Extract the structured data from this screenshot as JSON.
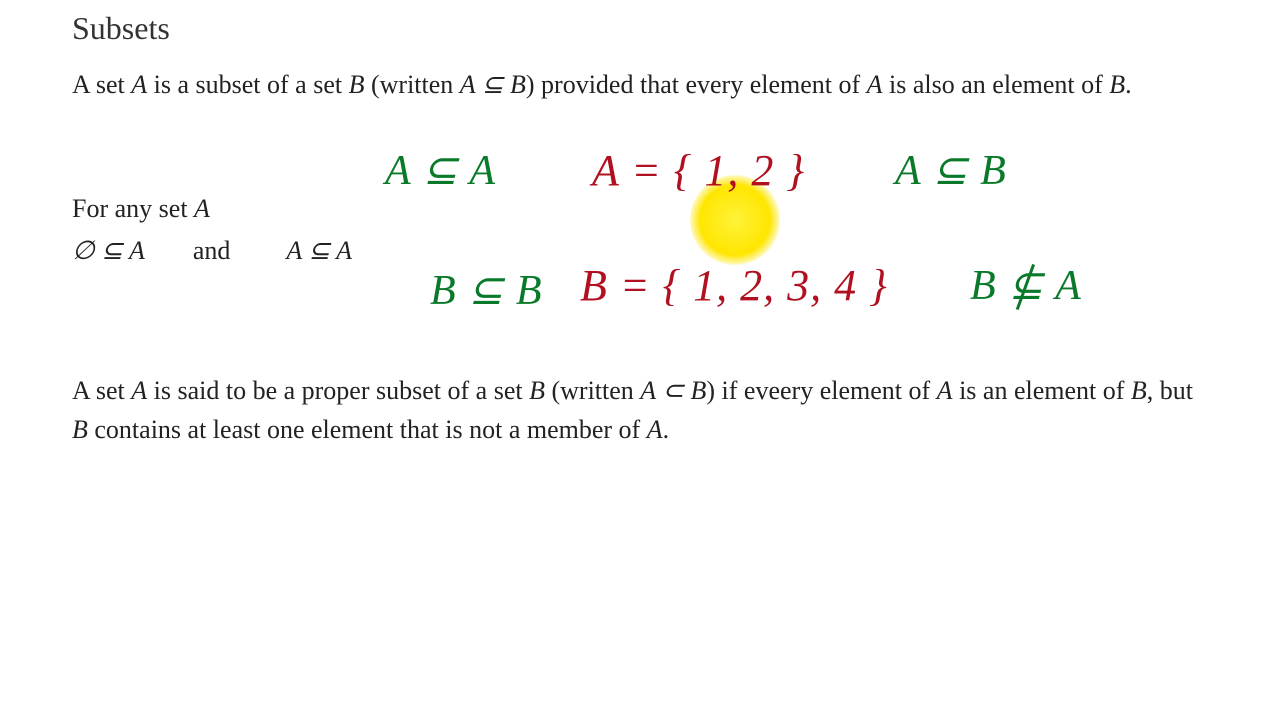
{
  "title": "Subsets",
  "para1_pre": "A set ",
  "para1_A": "A",
  "para1_mid1": " is a subset of a set ",
  "para1_B": "B",
  "para1_mid2": " (written ",
  "para1_sub": "A ⊆ B",
  "para1_mid3": ") provided that every element of ",
  "para1_A2": "A",
  "para1_mid4": " is also an element of ",
  "para1_B2": "B",
  "para1_end": ".",
  "para2_pre": "For any set ",
  "para2_A": "A",
  "line_empty": "∅ ⊆ A",
  "line_and": "and",
  "line_aa": "A ⊆ A",
  "para3_pre": "A set ",
  "para3_A": "A",
  "para3_mid1": " is said to be a proper subset of a set ",
  "para3_B": "B",
  "para3_mid2": " (written ",
  "para3_sub": "A ⊂ B",
  "para3_mid3": ") if eveery element of ",
  "para3_A2": "A",
  "para3_mid4": " is an element of ",
  "para3_B2": "B",
  "para3_mid5": ", but ",
  "para3_B3": "B",
  "para3_mid6": " contains at least one element that is not a member of ",
  "para3_A3": "A",
  "para3_end": ".",
  "hand": {
    "asa": "A ⊆ A",
    "adef": "A = { 1, 2 }",
    "asb": "A ⊆ B",
    "bsb": "B ⊆ B",
    "bdef": "B = { 1, 2, 3, 4 }",
    "bna_B": "B ",
    "bna_sym": "⊆",
    "bna_A": " A"
  }
}
